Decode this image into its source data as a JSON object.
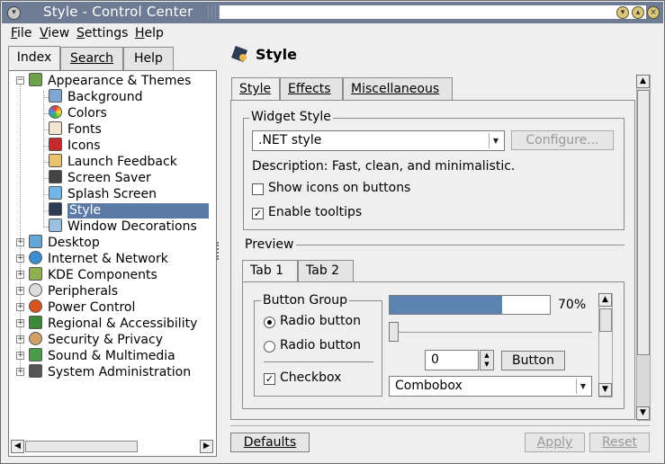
{
  "window": {
    "title": "Style - Control Center",
    "buttons": [
      "minimize",
      "maximize",
      "close"
    ]
  },
  "menubar": [
    "File",
    "View",
    "Settings",
    "Help"
  ],
  "left_tabs": [
    "Index",
    "Search",
    "Help"
  ],
  "tree": {
    "items": [
      {
        "label": "Appearance & Themes",
        "icon": "appearance-icon",
        "expanded": true
      },
      {
        "label": "Background",
        "icon": "background-icon"
      },
      {
        "label": "Colors",
        "icon": "colors-icon"
      },
      {
        "label": "Fonts",
        "icon": "fonts-icon"
      },
      {
        "label": "Icons",
        "icon": "icons-icon"
      },
      {
        "label": "Launch Feedback",
        "icon": "launch-feedback-icon"
      },
      {
        "label": "Screen Saver",
        "icon": "screen-saver-icon"
      },
      {
        "label": "Splash Screen",
        "icon": "splash-screen-icon"
      },
      {
        "label": "Style",
        "icon": "style-icon",
        "selected": true
      },
      {
        "label": "Window Decorations",
        "icon": "window-decorations-icon"
      },
      {
        "label": "Desktop",
        "icon": "desktop-icon"
      },
      {
        "label": "Internet & Network",
        "icon": "internet-icon"
      },
      {
        "label": "KDE Components",
        "icon": "kde-components-icon"
      },
      {
        "label": "Peripherals",
        "icon": "peripherals-icon"
      },
      {
        "label": "Power Control",
        "icon": "power-icon"
      },
      {
        "label": "Regional & Accessibility",
        "icon": "regional-icon"
      },
      {
        "label": "Security & Privacy",
        "icon": "security-icon"
      },
      {
        "label": "Sound & Multimedia",
        "icon": "sound-icon"
      },
      {
        "label": "System Administration",
        "icon": "system-admin-icon"
      }
    ]
  },
  "module": {
    "title": "Style",
    "tabs": [
      "Style",
      "Effects",
      "Miscellaneous"
    ],
    "widget_style": {
      "group_title": "Widget Style",
      "selected": ".NET style",
      "configure_label": "Configure...",
      "description": "Description: Fast, clean, and minimalistic.",
      "show_icons_label": "Show icons on buttons",
      "show_icons_checked": false,
      "tooltips_label": "Enable tooltips",
      "tooltips_checked": true
    },
    "preview": {
      "group_title": "Preview",
      "tabs": [
        "Tab 1",
        "Tab 2"
      ],
      "button_group_title": "Button Group",
      "radio1_label": "Radio button",
      "radio2_label": "Radio button",
      "checkbox_label": "Checkbox",
      "checkbox_checked": true,
      "progress_percent": 70,
      "progress_label": "70%",
      "spin_value": "0",
      "button_label": "Button",
      "combobox_value": "Combobox"
    }
  },
  "bottom": {
    "defaults_label": "Defaults",
    "apply_label": "Apply",
    "reset_label": "Reset"
  },
  "colors": {
    "titlebar": "#6d7b95",
    "selection": "#5b7ba6",
    "progress": "#5b84b1"
  }
}
